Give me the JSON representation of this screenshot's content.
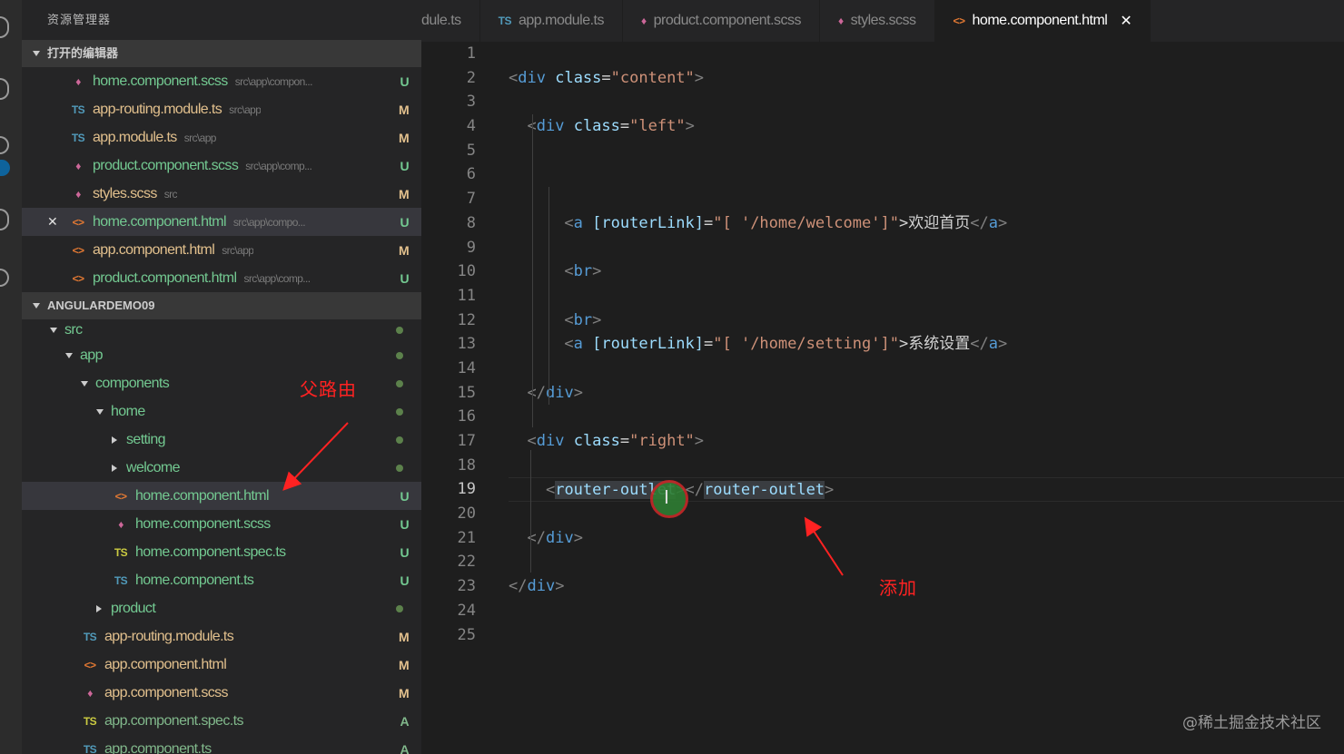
{
  "sidebar": {
    "title": "资源管理器",
    "open_editors_header": "打开的编辑器",
    "open_editors": [
      {
        "icon": "scss-icon",
        "glyph": "♦",
        "color": "#cd6799",
        "name": "home.component.scss",
        "path": "src\\app\\compon...",
        "status": "U"
      },
      {
        "icon": "ts-icon",
        "glyph": "TS",
        "color": "#519aba",
        "name": "app-routing.module.ts",
        "path": "src\\app",
        "status": "M"
      },
      {
        "icon": "ts-icon",
        "glyph": "TS",
        "color": "#519aba",
        "name": "app.module.ts",
        "path": "src\\app",
        "status": "M"
      },
      {
        "icon": "scss-icon",
        "glyph": "♦",
        "color": "#cd6799",
        "name": "product.component.scss",
        "path": "src\\app\\comp...",
        "status": "U"
      },
      {
        "icon": "scss-icon",
        "glyph": "♦",
        "color": "#cd6799",
        "name": "styles.scss",
        "path": "src",
        "status": "M"
      },
      {
        "icon": "html-icon",
        "glyph": "<>",
        "color": "#e37933",
        "name": "home.component.html",
        "path": "src\\app\\compo...",
        "status": "U"
      },
      {
        "icon": "html-icon",
        "glyph": "<>",
        "color": "#e37933",
        "name": "app.component.html",
        "path": "src\\app",
        "status": "M"
      },
      {
        "icon": "html-icon",
        "glyph": "<>",
        "color": "#e37933",
        "name": "product.component.html",
        "path": "src\\app\\comp...",
        "status": "U"
      }
    ],
    "project_header": "ANGULARDEMO09",
    "tree": [
      {
        "kind": "folder",
        "name": "src"
      },
      {
        "kind": "folder",
        "name": "app"
      },
      {
        "kind": "folder",
        "name": "components"
      },
      {
        "kind": "folder",
        "name": "home"
      },
      {
        "kind": "folder",
        "name": "setting"
      },
      {
        "kind": "folder",
        "name": "welcome"
      },
      {
        "kind": "file",
        "icon": "html-icon",
        "glyph": "<>",
        "color": "#e37933",
        "name": "home.component.html",
        "status": "U"
      },
      {
        "kind": "file",
        "icon": "scss-icon",
        "glyph": "♦",
        "color": "#cd6799",
        "name": "home.component.scss",
        "status": "U"
      },
      {
        "kind": "file",
        "icon": "ts-spec-icon",
        "glyph": "TS",
        "color": "#cbcb41",
        "name": "home.component.spec.ts",
        "status": "U"
      },
      {
        "kind": "file",
        "icon": "ts-icon",
        "glyph": "TS",
        "color": "#519aba",
        "name": "home.component.ts",
        "status": "U"
      },
      {
        "kind": "folder",
        "name": "product"
      },
      {
        "kind": "file",
        "icon": "ts-icon",
        "glyph": "TS",
        "color": "#519aba",
        "name": "app-routing.module.ts",
        "status": "M"
      },
      {
        "kind": "file",
        "icon": "html-icon",
        "glyph": "<>",
        "color": "#e37933",
        "name": "app.component.html",
        "status": "M"
      },
      {
        "kind": "file",
        "icon": "scss-icon",
        "glyph": "♦",
        "color": "#cd6799",
        "name": "app.component.scss",
        "status": "M"
      },
      {
        "kind": "file",
        "icon": "ts-spec-icon",
        "glyph": "TS",
        "color": "#cbcb41",
        "name": "app.component.spec.ts",
        "status": "A"
      },
      {
        "kind": "file",
        "icon": "ts-icon",
        "glyph": "TS",
        "color": "#519aba",
        "name": "app.component.ts",
        "status": "A"
      }
    ]
  },
  "tabs": [
    {
      "icon": "",
      "glyph": "",
      "color": "#8a8a8a",
      "label": "dule.ts"
    },
    {
      "icon": "ts-icon",
      "glyph": "TS",
      "color": "#519aba",
      "label": "app.module.ts"
    },
    {
      "icon": "scss-icon",
      "glyph": "♦",
      "color": "#cd6799",
      "label": "product.component.scss"
    },
    {
      "icon": "scss-icon",
      "glyph": "♦",
      "color": "#cd6799",
      "label": "styles.scss"
    },
    {
      "icon": "html-icon",
      "glyph": "<>",
      "color": "#e37933",
      "label": "home.component.html",
      "active": true
    }
  ],
  "editor": {
    "current_line": 19,
    "line_numbers": [
      "1",
      "2",
      "3",
      "4",
      "5",
      "6",
      "7",
      "8",
      "9",
      "10",
      "11",
      "12",
      "13",
      "14",
      "15",
      "16",
      "17",
      "18",
      "19",
      "20",
      "21",
      "22",
      "23",
      "24",
      "25"
    ],
    "lines": [
      [],
      [
        [
          "b",
          "<"
        ],
        [
          "t",
          "div"
        ],
        [
          "x",
          " "
        ],
        [
          "a",
          "class"
        ],
        [
          "x",
          "="
        ],
        [
          "s",
          "\"content\""
        ],
        [
          "b",
          ">"
        ]
      ],
      [],
      [
        [
          "x",
          "  "
        ],
        [
          "b",
          "<"
        ],
        [
          "t",
          "div"
        ],
        [
          "x",
          " "
        ],
        [
          "a",
          "class"
        ],
        [
          "x",
          "="
        ],
        [
          "s",
          "\"left\""
        ],
        [
          "b",
          ">"
        ]
      ],
      [],
      [],
      [],
      [
        [
          "x",
          "      "
        ],
        [
          "b",
          "<"
        ],
        [
          "t",
          "a"
        ],
        [
          "x",
          " "
        ],
        [
          "a",
          "[routerLink]"
        ],
        [
          "x",
          "="
        ],
        [
          "s",
          "\"[ '/home/welcome']\""
        ],
        [
          "x",
          ">欢迎首页"
        ],
        [
          "b",
          "</"
        ],
        [
          "t",
          "a"
        ],
        [
          "b",
          ">"
        ]
      ],
      [],
      [
        [
          "x",
          "      "
        ],
        [
          "b",
          "<"
        ],
        [
          "t",
          "br"
        ],
        [
          "b",
          ">"
        ]
      ],
      [],
      [
        [
          "x",
          "      "
        ],
        [
          "b",
          "<"
        ],
        [
          "t",
          "br"
        ],
        [
          "b",
          ">"
        ]
      ],
      [
        [
          "x",
          "      "
        ],
        [
          "b",
          "<"
        ],
        [
          "t",
          "a"
        ],
        [
          "x",
          " "
        ],
        [
          "a",
          "[routerLink]"
        ],
        [
          "x",
          "="
        ],
        [
          "s",
          "\"[ '/home/setting']\""
        ],
        [
          "x",
          ">系统设置"
        ],
        [
          "b",
          "</"
        ],
        [
          "t",
          "a"
        ],
        [
          "b",
          ">"
        ]
      ],
      [],
      [
        [
          "x",
          "  "
        ],
        [
          "b",
          "</"
        ],
        [
          "t",
          "div"
        ],
        [
          "b",
          ">"
        ]
      ],
      [],
      [
        [
          "x",
          "  "
        ],
        [
          "b",
          "<"
        ],
        [
          "t",
          "div"
        ],
        [
          "x",
          " "
        ],
        [
          "a",
          "class"
        ],
        [
          "x",
          "="
        ],
        [
          "s",
          "\"right\""
        ],
        [
          "b",
          ">"
        ]
      ],
      [],
      [
        [
          "x",
          "    "
        ],
        [
          "b",
          "<"
        ],
        [
          "th",
          "router-outlet"
        ],
        [
          "b",
          "></"
        ],
        [
          "th",
          "router-outlet"
        ],
        [
          "b",
          ">"
        ]
      ],
      [],
      [
        [
          "x",
          "  "
        ],
        [
          "b",
          "</"
        ],
        [
          "t",
          "div"
        ],
        [
          "b",
          ">"
        ]
      ],
      [],
      [
        [
          "b",
          "</"
        ],
        [
          "t",
          "div"
        ],
        [
          "b",
          ">"
        ]
      ],
      [],
      []
    ]
  },
  "annotations": {
    "parent_route": "父路由",
    "added": "添加"
  },
  "watermark": "@稀土掘金技术社区",
  "colors": {
    "arrow": "#ff2222",
    "modified": "#e2c08d",
    "untracked": "#73c991"
  }
}
